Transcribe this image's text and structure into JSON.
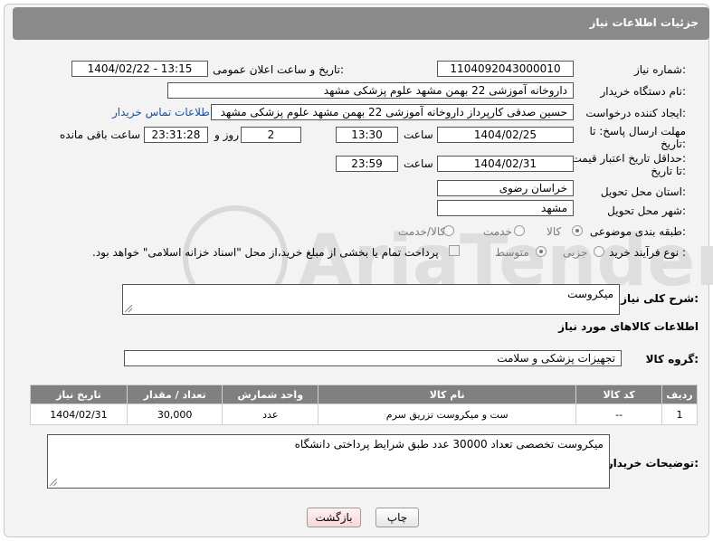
{
  "header": {
    "title": "جزئیات اطلاعات نیاز"
  },
  "fields": {
    "need_number": {
      "label": "شماره نیاز:",
      "value": "1104092043000010"
    },
    "announce_datetime": {
      "label": "تاریخ و ساعت اعلان عمومی:",
      "value": "1404/02/22 - 13:15"
    },
    "buyer_org": {
      "label": "نام دستگاه خریدار:",
      "value": "داروخانه آموزشی 22 بهمن مشهد   علوم پزشکی مشهد"
    },
    "creator": {
      "label": "ایجاد کننده درخواست:",
      "value": "حسین صدقی کارپرداز داروخانه آموزشی 22 بهمن مشهد   علوم پزشکی مشهد",
      "contact_link": "اطلاعات تماس خریدار"
    },
    "reply_deadline": {
      "label_line1": "مهلت ارسال پاسخ: تا",
      "label_line2": "تاریخ:",
      "date": "1404/02/25",
      "time_label": "ساعت",
      "time": "13:30",
      "days": "2",
      "days_label": "روز و",
      "remaining": "23:31:28",
      "remaining_label": "ساعت باقی مانده"
    },
    "price_validity": {
      "label_line1": "حداقل تاریخ اعتبار قیمت:",
      "label_line2": "تا تاریخ:",
      "date": "1404/02/31",
      "time_label": "ساعت",
      "time": "23:59"
    },
    "province": {
      "label": "استان محل تحویل:",
      "value": "خراسان رضوی"
    },
    "city": {
      "label": "شهر محل تحویل:",
      "value": "مشهد"
    },
    "category": {
      "label": "طبقه بندی موضوعی:",
      "options": [
        "کالا",
        "خدمت",
        "کالا/خدمت"
      ],
      "selected": "کالا"
    },
    "purchase_type": {
      "label": "نوع فرآیند خرید :",
      "options": [
        "جزیی",
        "متوسط"
      ],
      "selected": "متوسط",
      "note": "پرداخت تمام یا بخشی از مبلغ خرید،از محل \"اسناد خزانه اسلامی\" خواهد بود."
    }
  },
  "description": {
    "label": "شرح کلی نیاز:",
    "value": "میکروست"
  },
  "goods_section": {
    "title": "اطلاعات کالاهای مورد نیاز",
    "group_label": "گروه کالا:",
    "group_value": "تجهیزات پزشکی و سلامت"
  },
  "table": {
    "headers": [
      "ردیف",
      "کد کالا",
      "نام کالا",
      "واحد شمارش",
      "تعداد / مقدار",
      "تاریخ نیاز"
    ],
    "rows": [
      [
        "1",
        "--",
        "ست و میکروست تزریق سرم",
        "عدد",
        "30,000",
        "1404/02/31"
      ]
    ]
  },
  "buyer_notes": {
    "label": "توضیحات خریدار:",
    "value": "میکروست تخصصی تعداد 30000 عدد طبق شرایط پرداختی دانشگاه"
  },
  "buttons": {
    "print": "چاپ",
    "back": "بازگشت"
  },
  "watermark": {
    "text": "AriaTender.neT"
  },
  "colors": {
    "header_bg": "#8a8a8a",
    "link": "#1a4fa3",
    "back_button_bg": "#fbe3e3"
  }
}
